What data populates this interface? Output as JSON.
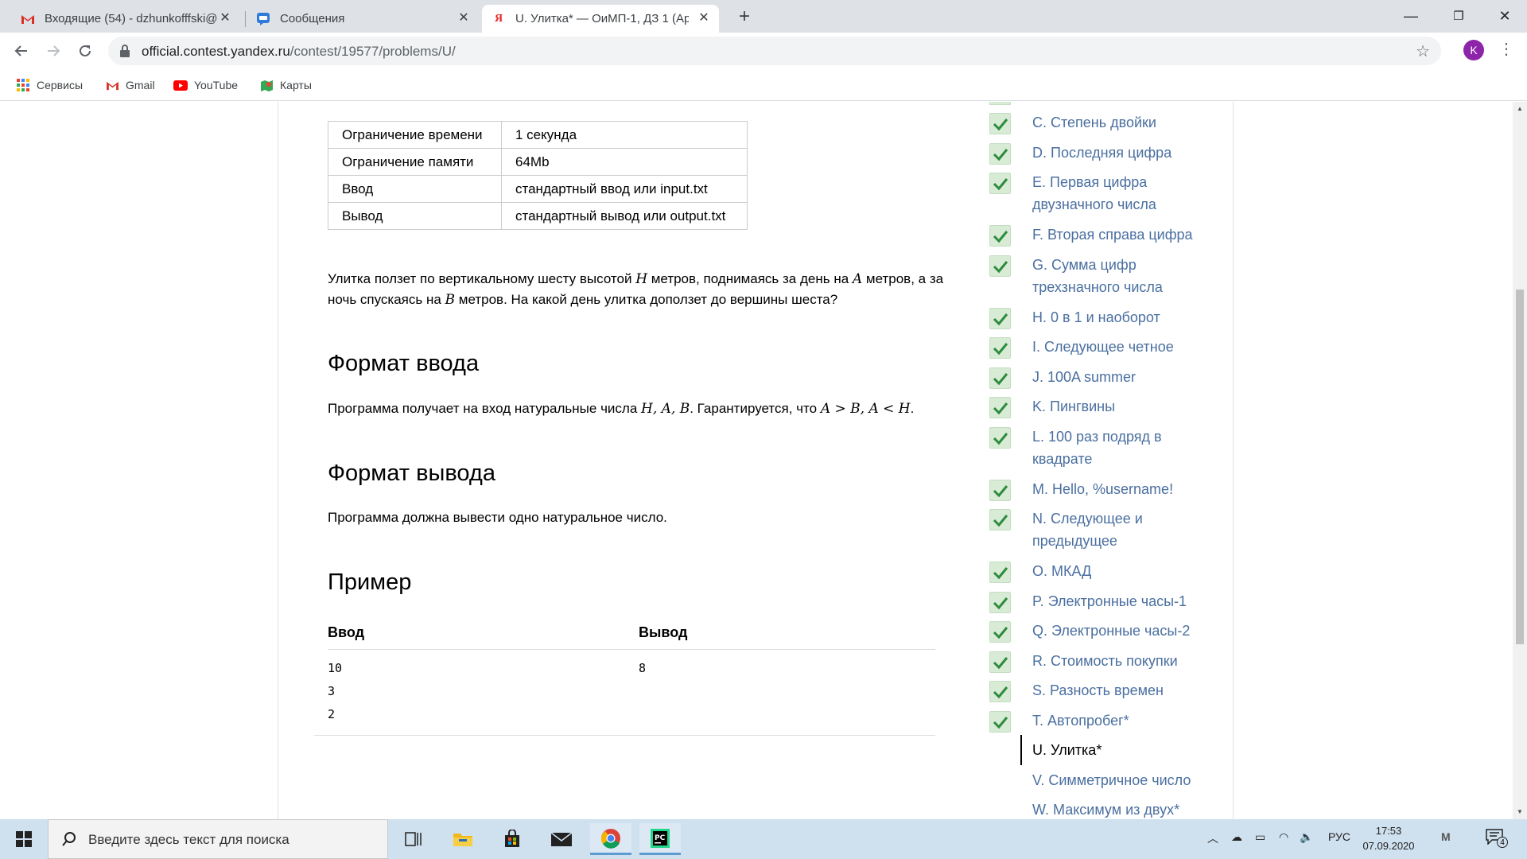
{
  "tabs": [
    {
      "title": "Входящие (54) - dzhunkofffski@",
      "icon": "gmail-icon"
    },
    {
      "title": "Сообщения",
      "icon": "chat-icon"
    },
    {
      "title": "U. Улитка* — ОиМП-1, ДЗ 1 (Ар",
      "icon": "yandex-icon"
    }
  ],
  "address": {
    "host": "official.contest.yandex.ru",
    "path": "/contest/19577/problems/U/"
  },
  "profile_initial": "K",
  "bookmarks": [
    {
      "label": "Сервисы",
      "icon": "apps-grid-icon"
    },
    {
      "label": "Gmail",
      "icon": "gmail-icon"
    },
    {
      "label": "YouTube",
      "icon": "youtube-icon"
    },
    {
      "label": "Карты",
      "icon": "maps-icon"
    }
  ],
  "limits": [
    {
      "key": "Ограничение времени",
      "value": "1 секунда"
    },
    {
      "key": "Ограничение памяти",
      "value": "64Mb"
    },
    {
      "key": "Ввод",
      "value": "стандартный ввод или input.txt"
    },
    {
      "key": "Вывод",
      "value": "стандартный вывод или output.txt"
    }
  ],
  "statement": {
    "t1": "Улитка ползет по вертикальному шесту высотой ",
    "m1": "H",
    "t2": " метров, поднимаясь за день на ",
    "m2": "A",
    "t3": " метров, а за ночь спускаясь на ",
    "m3": "B",
    "t4": " метров. На какой день улитка доползет до вершины шеста?"
  },
  "input_format": {
    "heading": "Формат ввода",
    "t1": "Программа получает на вход натуральные числа ",
    "m1": "H, A, B",
    "t2": ". Гарантируется, что ",
    "m2": "A > B, A < H",
    "t3": "."
  },
  "output_format": {
    "heading": "Формат вывода",
    "text": "Программа должна вывести одно натуральное число."
  },
  "example": {
    "heading": "Пример",
    "input_label": "Ввод",
    "output_label": "Вывод",
    "input_lines": [
      "10",
      "3",
      "2"
    ],
    "output_lines": [
      "8"
    ]
  },
  "problems": [
    {
      "label": "C. Степень двойки",
      "done": true
    },
    {
      "label": "D. Последняя цифра",
      "done": true
    },
    {
      "label": "E. Первая цифра двузначного числа",
      "done": true
    },
    {
      "label": "F. Вторая справа цифра",
      "done": true
    },
    {
      "label": "G. Сумма цифр трехзначного числа",
      "done": true
    },
    {
      "label": "H. 0 в 1 и наоборот",
      "done": true
    },
    {
      "label": "I. Следующее четное",
      "done": true
    },
    {
      "label": "J. 100A summer",
      "done": true
    },
    {
      "label": "K. Пингвины",
      "done": true
    },
    {
      "label": "L. 100 раз подряд в квадрате",
      "done": true
    },
    {
      "label": "M. Hello, %username!",
      "done": true
    },
    {
      "label": "N. Следующее и предыдущее",
      "done": true
    },
    {
      "label": "O. МКАД",
      "done": true
    },
    {
      "label": "P. Электронные часы-1",
      "done": true
    },
    {
      "label": "Q. Электронные часы-2",
      "done": true
    },
    {
      "label": "R. Стоимость покупки",
      "done": true
    },
    {
      "label": "S. Разность времен",
      "done": true
    },
    {
      "label": "T. Автопробег*",
      "done": true
    },
    {
      "label": "U. Улитка*",
      "done": false,
      "current": true
    },
    {
      "label": "V. Симметричное число",
      "done": false
    },
    {
      "label": "W. Максимум из двух*",
      "done": false
    }
  ],
  "taskbar": {
    "search_placeholder": "Введите здесь текст для поиска",
    "language": "РУС",
    "time": "17:53",
    "date": "07.09.2020",
    "notifications": "4"
  },
  "colors": {
    "link": "#4a6fa0",
    "check_bg": "#d7ebd5",
    "check_mark": "#2e8b3e",
    "taskbar": "#cfe0ef"
  }
}
